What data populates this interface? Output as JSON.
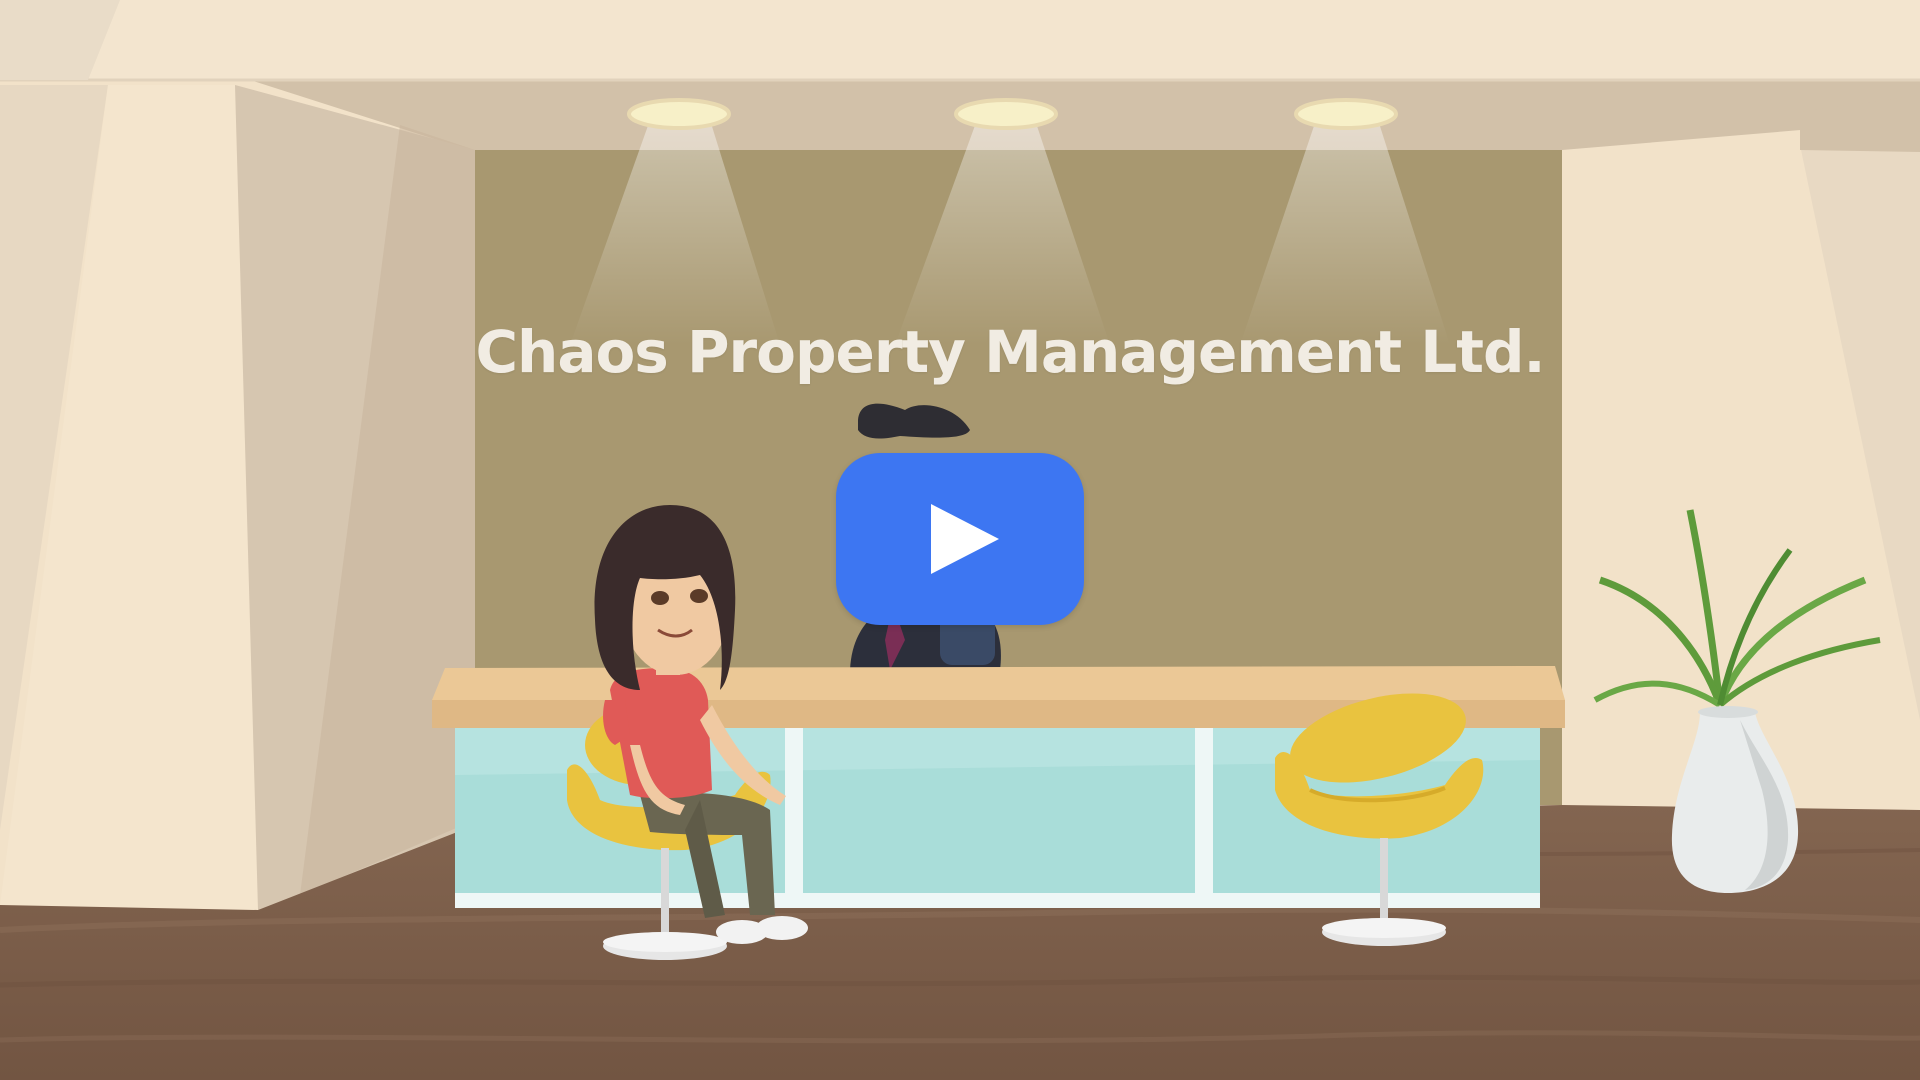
{
  "video": {
    "sign_text": "Chaos Property Management Ltd.",
    "play_icon": "play-icon"
  },
  "colors": {
    "ceiling": "#f3e5cf",
    "back_wall": "#a89870",
    "side_wall": "#f2e2c9",
    "desk_top": "#ebc896",
    "desk_glass": "#a9ddd9",
    "floor": "#7b5f4a",
    "chair": "#e9c33f",
    "shirt": "#e05a57",
    "play_button": "#3d76f2"
  }
}
